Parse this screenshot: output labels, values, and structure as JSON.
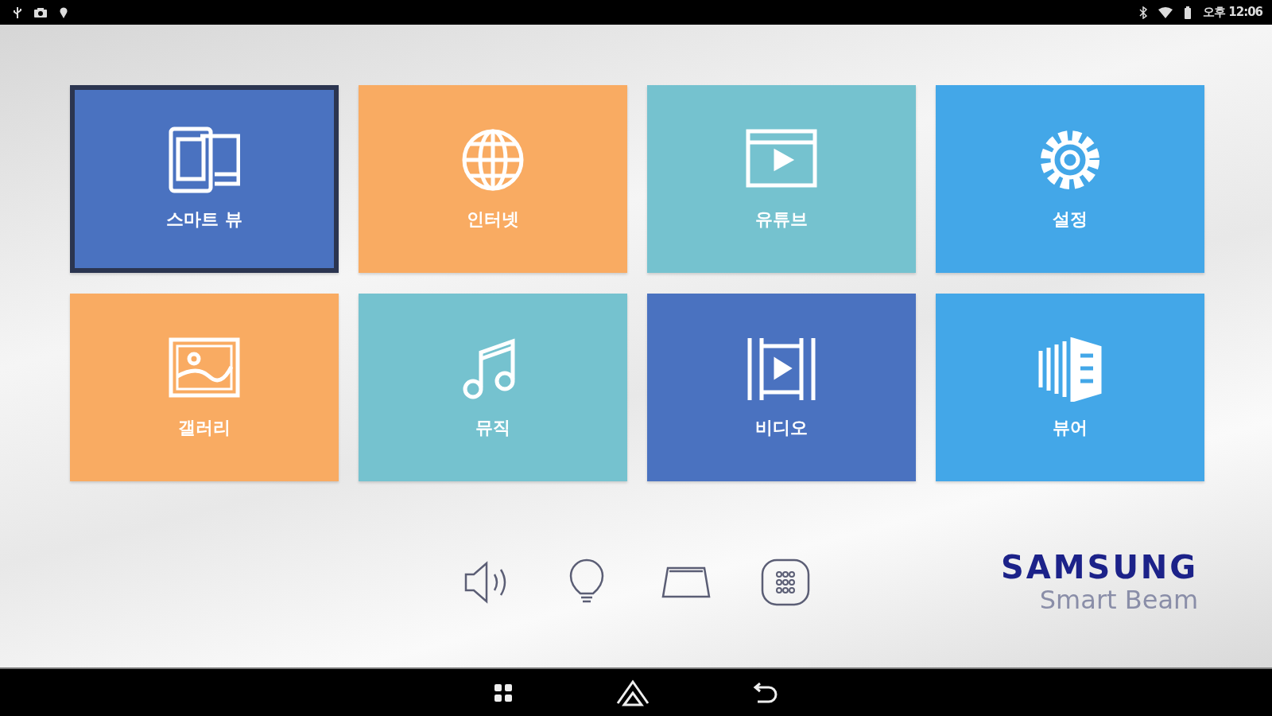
{
  "status_bar": {
    "time": "오후 12:06"
  },
  "tiles": [
    {
      "label": "스마트 뷰",
      "kind": "devices",
      "color": "#4a72c0",
      "selected": true
    },
    {
      "label": "인터넷",
      "kind": "globe",
      "color": "#f9ab62",
      "selected": false
    },
    {
      "label": "유튜브",
      "kind": "player",
      "color": "#75c2cf",
      "selected": false
    },
    {
      "label": "설정",
      "kind": "gear",
      "color": "#43a7e8",
      "selected": false
    },
    {
      "label": "갤러리",
      "kind": "image",
      "color": "#f9ab62",
      "selected": false
    },
    {
      "label": "뮤직",
      "kind": "music",
      "color": "#75c2cf",
      "selected": false
    },
    {
      "label": "비디오",
      "kind": "film",
      "color": "#4a72c0",
      "selected": false
    },
    {
      "label": "뷰어",
      "kind": "viewer",
      "color": "#43a7e8",
      "selected": false
    }
  ],
  "quick_controls": [
    {
      "kind": "speaker"
    },
    {
      "kind": "bulb"
    },
    {
      "kind": "keystone"
    },
    {
      "kind": "apps"
    }
  ],
  "brand": {
    "name": "SAMSUNG",
    "product": "Smart Beam"
  }
}
